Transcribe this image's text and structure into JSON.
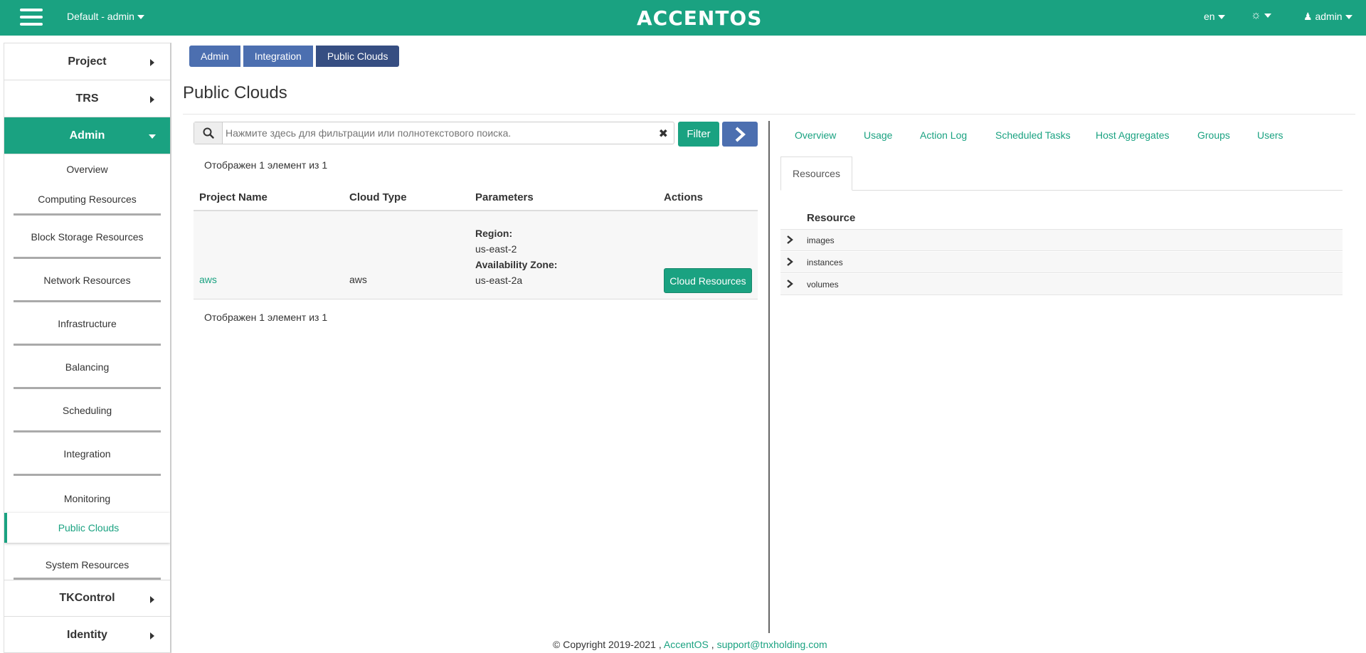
{
  "topbar": {
    "project_switch": "Default - admin",
    "logo": "ACCENTOS",
    "language": "en",
    "user": "admin"
  },
  "sidebar": {
    "sections_top": [
      {
        "label": "Project"
      },
      {
        "label": "TRS"
      }
    ],
    "active_section": "Admin",
    "subitems": [
      {
        "label": "Overview"
      },
      {
        "label": "Computing Resources"
      },
      {
        "label": "Block Storage Resources"
      },
      {
        "label": "Network Resources"
      },
      {
        "label": "Infrastructure"
      },
      {
        "label": "Balancing"
      },
      {
        "label": "Scheduling"
      },
      {
        "label": "Integration"
      },
      {
        "label": "Monitoring"
      },
      {
        "label": "Public Clouds"
      },
      {
        "label": "System Resources"
      }
    ],
    "sections_bottom": [
      {
        "label": "TKControl"
      },
      {
        "label": "Identity"
      }
    ]
  },
  "breadcrumb": [
    "Admin",
    "Integration",
    "Public Clouds"
  ],
  "page_title": "Public Clouds",
  "search": {
    "placeholder": "Нажмите здесь для фильтрации или полнотекстового поиска.",
    "filter_label": "Filter"
  },
  "count_text": "Отображен 1 элемент из 1",
  "table": {
    "columns": [
      "Project Name",
      "Cloud Type",
      "Parameters",
      "Actions"
    ],
    "rows": [
      {
        "project_name": "aws",
        "cloud_type": "aws",
        "region_label": "Region:",
        "region": "us-east-2",
        "az_label": "Availability Zone:",
        "az": "us-east-2a",
        "action": "Cloud Resources"
      }
    ]
  },
  "right_tabs": [
    "Overview",
    "Usage",
    "Action Log",
    "Scheduled Tasks",
    "Host Aggregates",
    "Groups",
    "Users"
  ],
  "active_tab": "Resources",
  "resources": {
    "header": "Resource",
    "items": [
      "images",
      "instances",
      "volumes"
    ]
  },
  "footer": {
    "copyright": "© Copyright 2019-2021 , ",
    "brand": "AccentOS",
    "separator": " , ",
    "email": "support@tnxholding.com"
  },
  "colors": {
    "accent": "#1aa281",
    "breadcrumb": "#4c6fb0",
    "breadcrumb_active": "#364e82"
  }
}
